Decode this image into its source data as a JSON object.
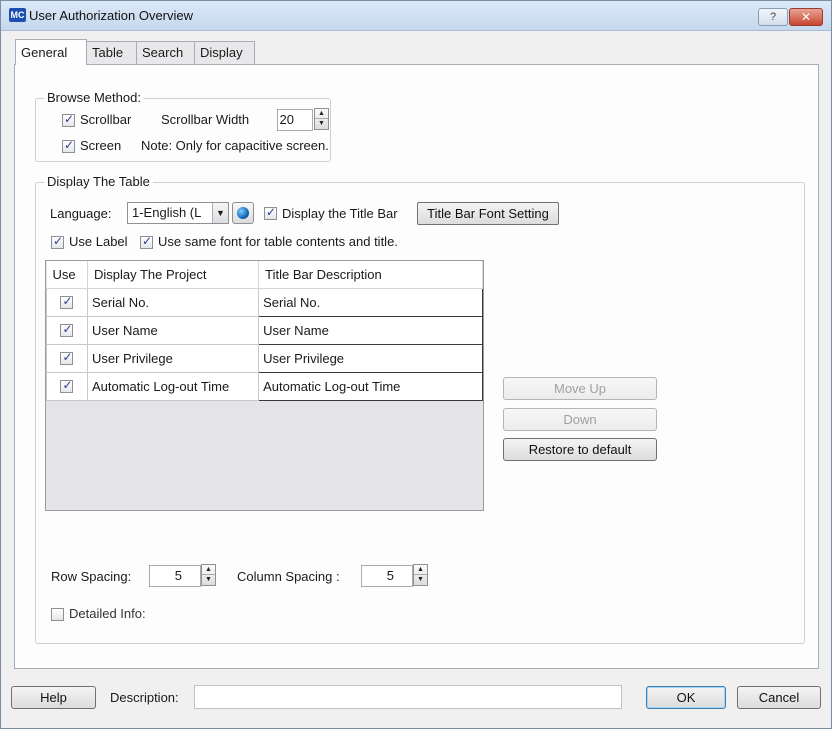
{
  "window": {
    "title": "User Authorization Overview",
    "app_icon": "MC",
    "help_glyph": "?",
    "close_glyph": "✕"
  },
  "tabs": [
    {
      "label": "General",
      "active": true
    },
    {
      "label": "Table",
      "active": false
    },
    {
      "label": "Search",
      "active": false
    },
    {
      "label": "Display",
      "active": false
    }
  ],
  "browse_method": {
    "legend": "Browse Method:",
    "scrollbar_label": "Scrollbar",
    "scrollbar_checked": true,
    "scrollbar_width_label": "Scrollbar Width",
    "scrollbar_width_value": "20",
    "screen_label": "Screen",
    "screen_checked": true,
    "note": "Note: Only for capacitive screen."
  },
  "display_table": {
    "legend": "Display The Table",
    "language_label": "Language:",
    "language_value": "1-English (L",
    "display_title_bar_label": "Display the Title Bar",
    "title_bar_font_button": "Title Bar Font Setting",
    "use_label_label": "Use Label",
    "same_font_label": "Use same font for table contents and title.",
    "columns": [
      "Use",
      "Display The Project",
      "Title Bar Description"
    ],
    "rows": [
      {
        "use": true,
        "project": "Serial No.",
        "description": "Serial No."
      },
      {
        "use": true,
        "project": "User Name",
        "description": "User Name"
      },
      {
        "use": true,
        "project": "User Privilege",
        "description": "User Privilege"
      },
      {
        "use": true,
        "project": "Automatic Log-out Time",
        "description": "Automatic Log-out Time"
      }
    ],
    "move_up_button": "Move Up",
    "down_button": "Down",
    "restore_button": "Restore to default",
    "row_spacing_label": "Row Spacing:",
    "row_spacing_value": "5",
    "column_spacing_label": "Column Spacing :",
    "column_spacing_value": "5",
    "detailed_info_label": "Detailed Info:"
  },
  "footer": {
    "help_button": "Help",
    "description_label": "Description:",
    "description_value": "",
    "ok_button": "OK",
    "cancel_button": "Cancel"
  }
}
